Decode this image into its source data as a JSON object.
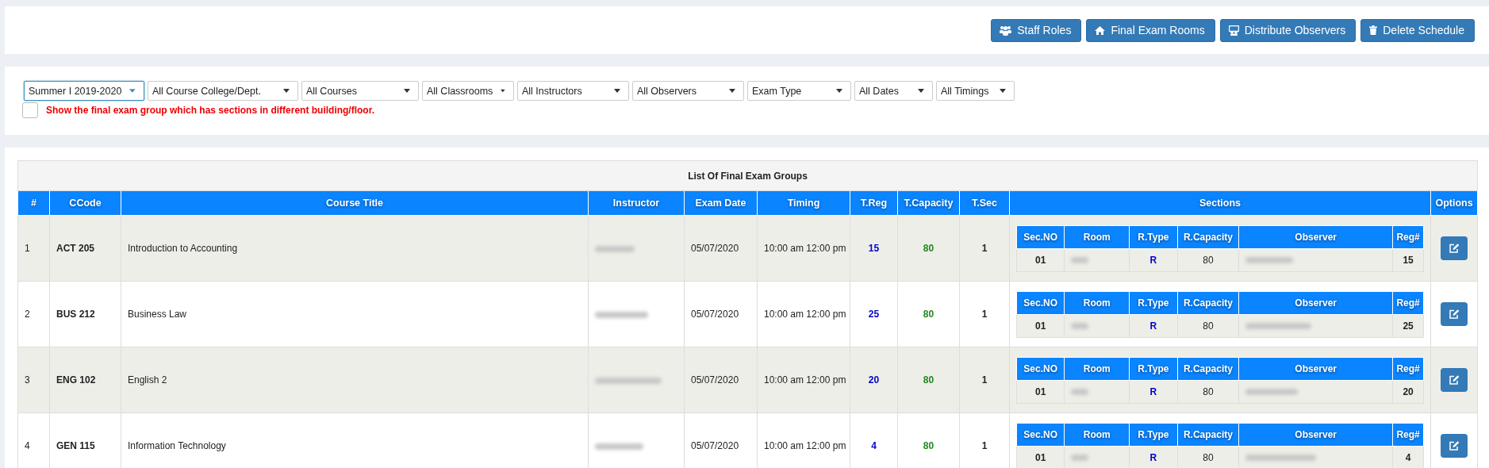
{
  "toolbar": {
    "buttons": [
      {
        "label": "Staff Roles"
      },
      {
        "label": "Final Exam Rooms"
      },
      {
        "label": "Distribute Observers"
      },
      {
        "label": "Delete Schedule"
      }
    ]
  },
  "filters": [
    {
      "value": "Summer I 2019-2020",
      "focused": true
    },
    {
      "value": "All Course College/Dept.",
      "focused": false
    },
    {
      "value": "All Courses",
      "focused": false
    },
    {
      "value": "All Classrooms",
      "focused": false
    },
    {
      "value": "All Instructors",
      "focused": false
    },
    {
      "value": "All Observers",
      "focused": false
    },
    {
      "value": "Exam Type",
      "focused": false
    },
    {
      "value": "All Dates",
      "focused": false
    },
    {
      "value": "All Timings",
      "focused": false
    }
  ],
  "checkbox": {
    "label": "Show the final exam group which has sections in different building/floor.",
    "checked": false
  },
  "table": {
    "title": "List Of Final Exam Groups",
    "columns": [
      "#",
      "CCode",
      "Course Title",
      "Instructor",
      "Exam Date",
      "Timing",
      "T.Reg",
      "T.Capacity",
      "T.Sec",
      "Sections",
      "Options"
    ],
    "rows": [
      {
        "num": "1",
        "code": "ACT 205",
        "title": "Introduction to Accounting",
        "date": "05/07/2020",
        "timing": "10:00 am 12:00 pm",
        "t_reg": "15",
        "t_capacity": "80",
        "t_sec": "1",
        "section": {
          "columns": [
            "Sec.NO",
            "Room",
            "R.Type",
            "R.Capacity",
            "Observer",
            "Reg#"
          ],
          "sec_no": "01",
          "r_type": "R",
          "r_capacity": "80",
          "reg": "15"
        }
      },
      {
        "num": "2",
        "code": "BUS 212",
        "title": "Business Law",
        "date": "05/07/2020",
        "timing": "10:00 am 12:00 pm",
        "t_reg": "25",
        "t_capacity": "80",
        "t_sec": "1",
        "section": {
          "columns": [
            "Sec.NO",
            "Room",
            "R.Type",
            "R.Capacity",
            "Observer",
            "Reg#"
          ],
          "sec_no": "01",
          "r_type": "R",
          "r_capacity": "80",
          "reg": "25"
        }
      },
      {
        "num": "3",
        "code": "ENG 102",
        "title": "English 2",
        "date": "05/07/2020",
        "timing": "10:00 am 12:00 pm",
        "t_reg": "20",
        "t_capacity": "80",
        "t_sec": "1",
        "section": {
          "columns": [
            "Sec.NO",
            "Room",
            "R.Type",
            "R.Capacity",
            "Observer",
            "Reg#"
          ],
          "sec_no": "01",
          "r_type": "R",
          "r_capacity": "80",
          "reg": "20"
        }
      },
      {
        "num": "4",
        "code": "GEN 115",
        "title": "Information Technology",
        "date": "05/07/2020",
        "timing": "10:00 am 12:00 pm",
        "t_reg": "4",
        "t_capacity": "80",
        "t_sec": "1",
        "section": {
          "columns": [
            "Sec.NO",
            "Room",
            "R.Type",
            "R.Capacity",
            "Observer",
            "Reg#"
          ],
          "sec_no": "01",
          "r_type": "R",
          "r_capacity": "80",
          "reg": "4"
        }
      }
    ]
  }
}
